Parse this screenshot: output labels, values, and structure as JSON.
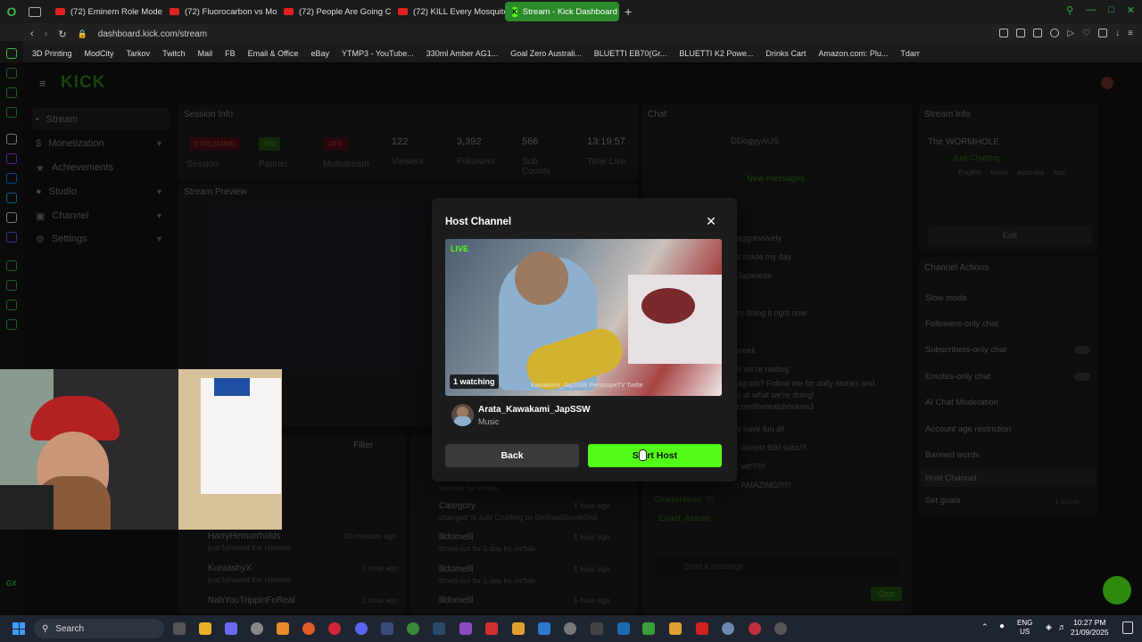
{
  "browser": {
    "tabs": [
      {
        "label": "(72) Eminem Role Model |",
        "active": false
      },
      {
        "label": "(72) Fluorocarbon vs Mo",
        "active": false
      },
      {
        "label": "(72) People Are Going Cr",
        "active": false
      },
      {
        "label": "(72) KILL Every Mosquito",
        "active": false
      },
      {
        "label": "Stream - Kick Dashboard",
        "active": true
      }
    ],
    "url": "dashboard.kick.com/stream",
    "bookmarks": [
      "3D Printing",
      "ModCity",
      "Tarkov",
      "Twitch",
      "Mail",
      "FB",
      "Email & Office",
      "eBay",
      "YTMP3 - YouTube...",
      "330ml Amber AG1...",
      "Goal Zero Australi...",
      "BLUETTI EB70(Gr...",
      "BLUETTI K2 Powe...",
      "Drinks Cart",
      "Amazon.com: Plu...",
      "Tdarr"
    ]
  },
  "sidebar": {
    "items": [
      {
        "label": "Stream",
        "icon": "stream-icon"
      },
      {
        "label": "Monetization",
        "icon": "dollar-icon"
      },
      {
        "label": "Achievements",
        "icon": "trophy-icon"
      },
      {
        "label": "Studio",
        "icon": "studio-icon"
      },
      {
        "label": "Channel",
        "icon": "channel-icon"
      },
      {
        "label": "Settings",
        "icon": "gear-icon"
      }
    ]
  },
  "session": {
    "title": "Session Info",
    "stats": [
      {
        "badge": "STREAMING",
        "label": "Session"
      },
      {
        "badge": "ON",
        "label": "Partner"
      },
      {
        "badge": "OFF",
        "label": "Multistream"
      },
      {
        "value": "122",
        "label": "Viewers"
      },
      {
        "value": "3,392",
        "label": "Followers"
      },
      {
        "value": "566",
        "label": "Sub Counts"
      },
      {
        "value": "13:19:57",
        "label": "Time Live"
      }
    ],
    "preview_title": "Stream Preview"
  },
  "chat": {
    "title": "Chat",
    "new_messages": "New messages",
    "top_user": "DDoggyAUS",
    "lines": [
      "aggressively",
      "s made my day",
      "Japanese",
      "m doing it right now",
      "week",
      "h we're raiding",
      "agram? Follow me for daily stories and",
      "s at what we're doing!",
      "com/therealshookon3",
      "s have fun all",
      ": almost 600 subs!!!",
      ": wtf?!!!!",
      ": AMAZING!!!!!!"
    ],
    "charlie": "CharlieHorse: !!!!",
    "exiled": "Exiled_Azazel:",
    "input_placeholder": "Send a message",
    "send_label": "Chat"
  },
  "activity": {
    "filter_label": "Filter",
    "left": [
      {
        "name": "HarryHemorrholds",
        "text": "just followed the channel",
        "time": "50 minutes ago"
      },
      {
        "name": "KuroashyX",
        "text": "just followed the channel",
        "time": "1 hour ago"
      },
      {
        "name": "NahYouTrippinFoReal",
        "text": "",
        "time": "1 hour ago"
      }
    ],
    "right": [
      {
        "name": "",
        "text": "banned by nicfalk",
        "time": "1 hour ago"
      },
      {
        "name": "Category",
        "text": "changed to Just Chatting by theRealShookOn3",
        "time": "1 hour ago"
      },
      {
        "name": "llldomelll",
        "text": "timed out for 1 day by nicfalk",
        "time": "1 hour ago"
      },
      {
        "name": "llldomelll",
        "text": "timed out for 1 day by nicfalk",
        "time": "1 hour ago"
      },
      {
        "name": "llldomelll",
        "text": "",
        "time": "1 hour ago"
      }
    ]
  },
  "stream_info": {
    "title": "Stream Info",
    "stream_name": "The WORMHOLE",
    "category": "Just Chatting",
    "tags": [
      "English",
      "travel",
      "australia",
      "Aus"
    ],
    "edit_label": "Edit"
  },
  "channel_actions": {
    "title": "Channel Actions",
    "items": [
      "Slow mode",
      "Followers-only chat",
      "Subscribers-only chat",
      "Emotes-only chat",
      "AI Chat Moderation",
      "Account age restriction",
      "Banned words",
      "Host Channel",
      "Set goals"
    ],
    "set_goals_status": "1 active"
  },
  "modal": {
    "title": "Host Channel",
    "live_badge": "LIVE",
    "watching": "1 watching",
    "watermark": "Kawakami_JapSSW  PeriscopeTV  Twitte",
    "channel_name": "Arata_Kawakami_JapSSW",
    "category": "Music",
    "back_label": "Back",
    "start_label": "Start Host"
  },
  "taskbar": {
    "search_label": "Search",
    "lang": "ENG",
    "region": "US",
    "time": "10:27 PM",
    "date": "21/09/2025"
  },
  "colors": {
    "kick_green": "#53fc18",
    "badge_red": "#e0203a",
    "background": "#121212"
  }
}
